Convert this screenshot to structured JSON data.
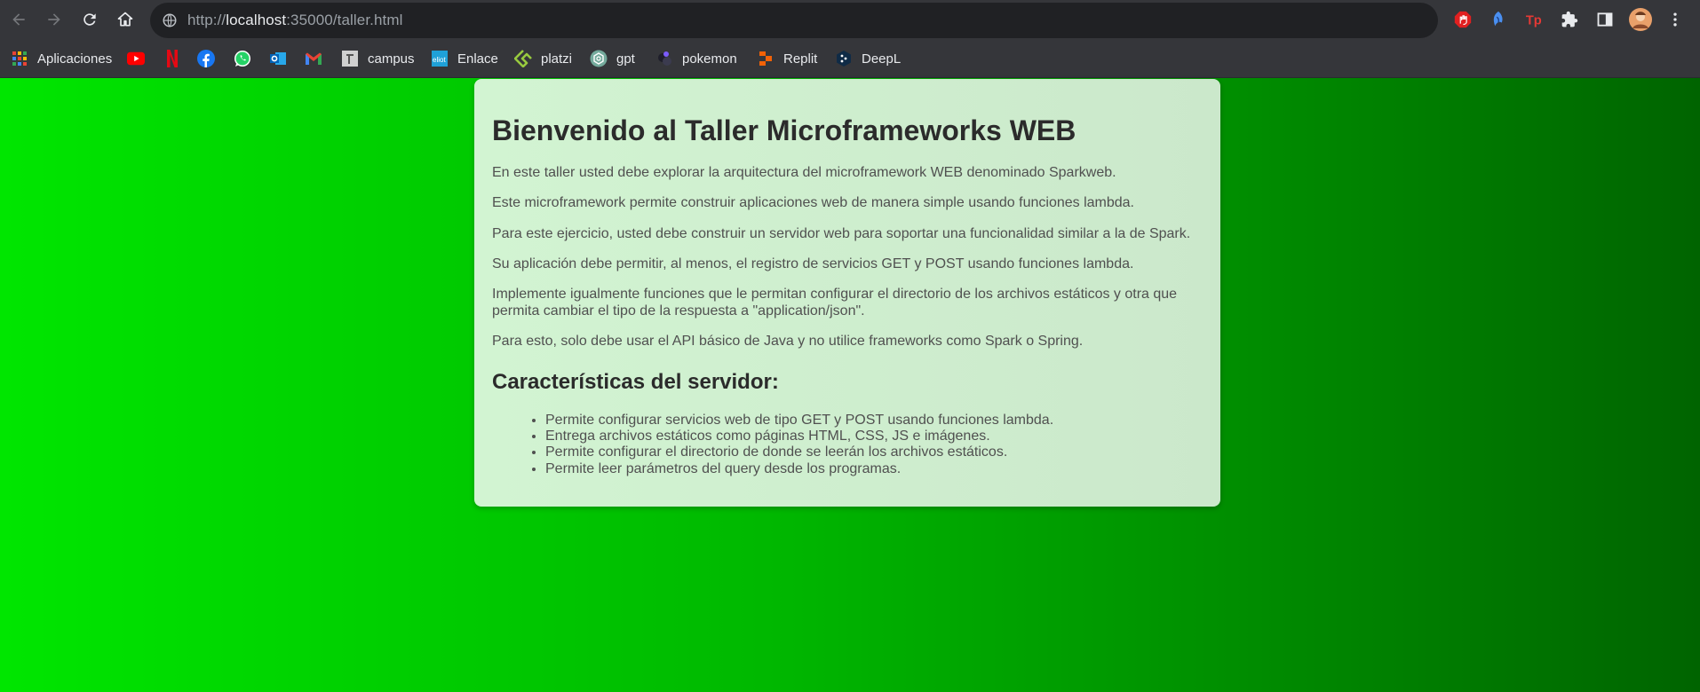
{
  "browser": {
    "url_scheme": "http://",
    "url_host": "localhost",
    "url_rest": ":35000/taller.html"
  },
  "bookmarks": [
    {
      "label": "Aplicaciones",
      "icon": "apps-grid-icon"
    },
    {
      "label": "",
      "icon": "youtube-icon"
    },
    {
      "label": "",
      "icon": "netflix-icon"
    },
    {
      "label": "",
      "icon": "facebook-icon"
    },
    {
      "label": "",
      "icon": "whatsapp-icon"
    },
    {
      "label": "",
      "icon": "outlook-icon"
    },
    {
      "label": "",
      "icon": "gmail-icon"
    },
    {
      "label": "campus",
      "icon": "campus-icon"
    },
    {
      "label": "Enlace",
      "icon": "enlace-icon"
    },
    {
      "label": "platzi",
      "icon": "platzi-icon"
    },
    {
      "label": "gpt",
      "icon": "chatgpt-icon"
    },
    {
      "label": "pokemon",
      "icon": "pokemon-icon"
    },
    {
      "label": "Replit",
      "icon": "replit-icon"
    },
    {
      "label": "DeepL",
      "icon": "deepl-icon"
    }
  ],
  "page": {
    "title": "Bienvenido al Taller Microframeworks WEB",
    "paragraphs": [
      "En este taller usted debe explorar la arquitectura del microframework WEB denominado Sparkweb.",
      "Este microframework permite construir aplicaciones web de manera simple usando funciones lambda.",
      "Para este ejercicio, usted debe construir un servidor web para soportar una funcionalidad similar a la de Spark.",
      "Su aplicación debe permitir, al menos, el registro de servicios GET y POST usando funciones lambda.",
      "Implemente igualmente funciones que le permitan configurar el directorio de los archivos estáticos y otra que permita cambiar el tipo de la respuesta a \"application/json\".",
      "Para esto, solo debe usar el API básico de Java y no utilice frameworks como Spark o Spring."
    ],
    "subtitle": "Características del servidor:",
    "features": [
      "Permite configurar servicios web de tipo GET y POST usando funciones lambda.",
      "Entrega archivos estáticos como páginas HTML, CSS, JS e imágenes.",
      "Permite configurar el directorio de donde se leerán los archivos estáticos.",
      "Permite leer parámetros del query desde los programas."
    ]
  },
  "colors": {
    "gradient_start": "#00e600",
    "gradient_end": "#006400",
    "card_bg": "#d2f4d2",
    "chrome_bg": "#35363a"
  }
}
